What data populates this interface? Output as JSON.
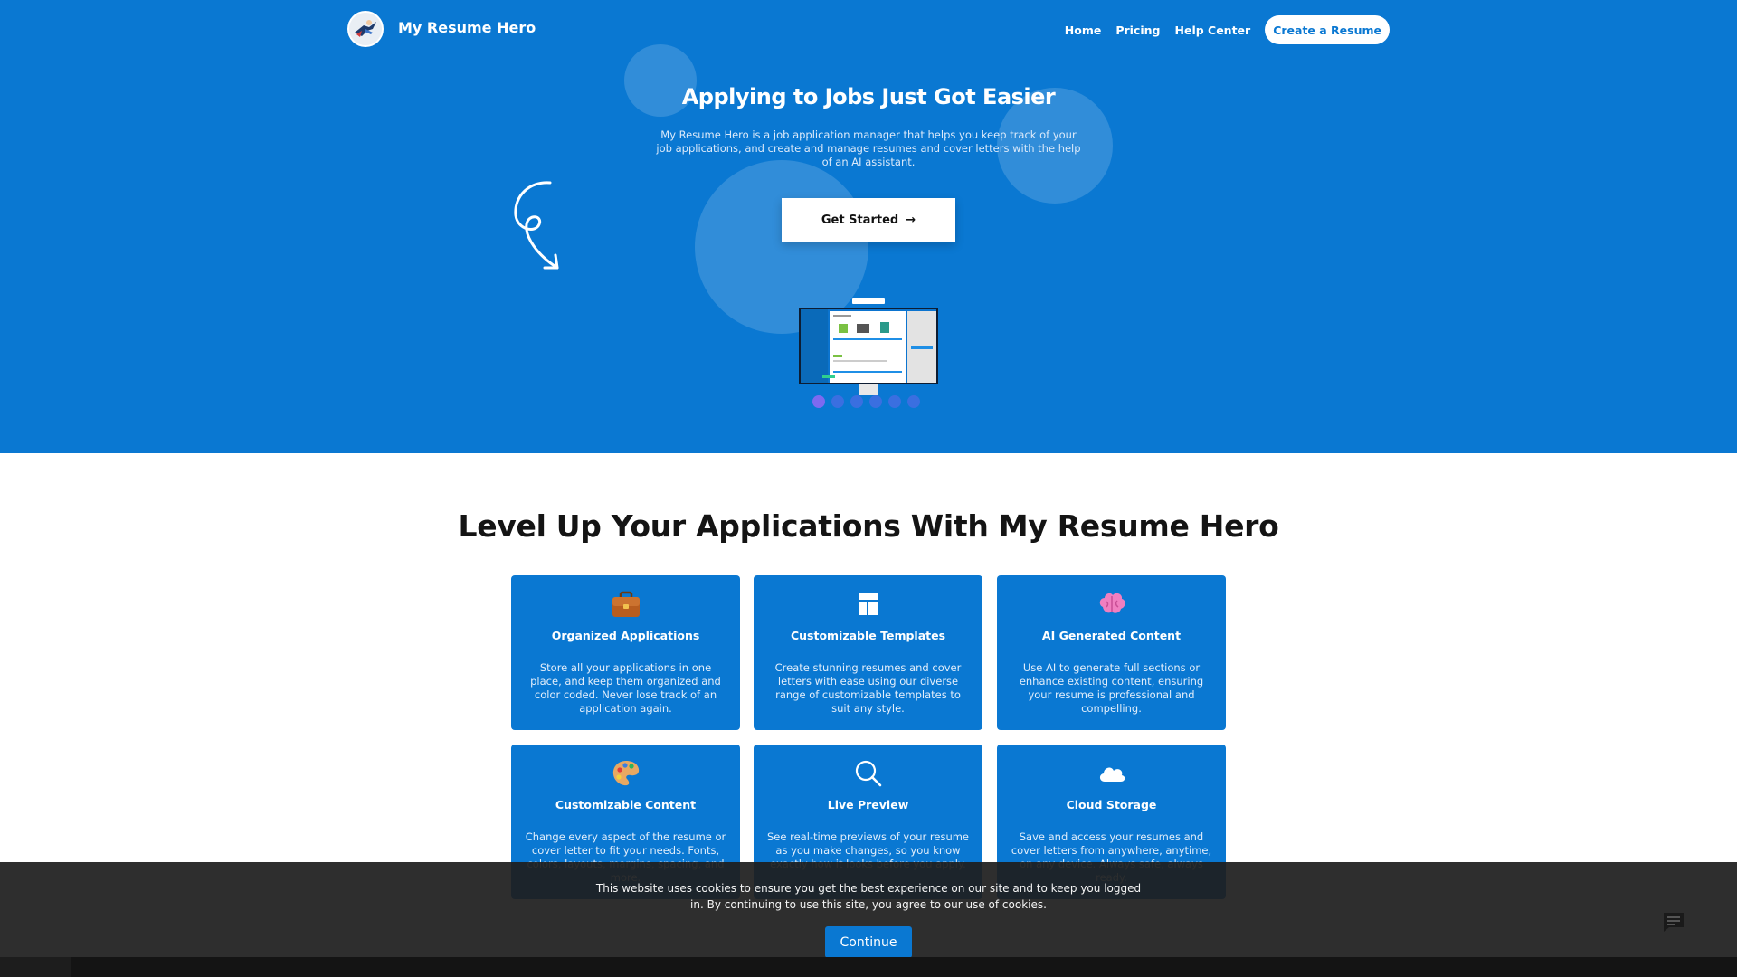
{
  "nav": {
    "brand": "My Resume Hero",
    "links": [
      "Home",
      "Pricing",
      "Help Center"
    ],
    "cta": "Create a Resume"
  },
  "hero": {
    "title": "Applying to Jobs Just Got Easier",
    "subtitle": "My Resume Hero is a job application manager that helps you keep track of your job applications, and create and manage resumes and cover letters with the help of an AI assistant.",
    "button": "Get Started",
    "carousel_active_index": 0,
    "carousel_count": 6
  },
  "features": {
    "title": "Level Up Your Applications With My Resume Hero",
    "cards": [
      {
        "icon": "briefcase-icon",
        "title": "Organized Applications",
        "text": "Store all your applications in one place, and keep them organized and color coded. Never lose track of an application again."
      },
      {
        "icon": "layout-icon",
        "title": "Customizable Templates",
        "text": "Create stunning resumes and cover letters with ease using our diverse range of customizable templates to suit any style."
      },
      {
        "icon": "brain-icon",
        "title": "AI Generated Content",
        "text": "Use AI to generate full sections or enhance existing content, ensuring your resume is professional and compelling."
      },
      {
        "icon": "palette-icon",
        "title": "Customizable Content",
        "text": "Change every aspect of the resume or cover letter to fit your needs. Fonts, colors, layouts, margins, spacing, and more."
      },
      {
        "icon": "magnifier-icon",
        "title": "Live Preview",
        "text": "See real-time previews of your resume as you make changes, so you know exactly how it looks before you apply."
      },
      {
        "icon": "cloud-icon",
        "title": "Cloud Storage",
        "text": "Save and access your resumes and cover letters from anywhere, anytime, on any device. Always safe, always ready."
      }
    ]
  },
  "cookie": {
    "text": "This website uses cookies to ensure you get the best experience on our site and to keep you logged in. By continuing to use this site, you agree to our use of cookies.",
    "button": "Continue"
  },
  "colors": {
    "brand_blue": "#0a78d2",
    "carousel_dot": "#3a6fe0",
    "carousel_dot_active": "#7d6af0"
  }
}
